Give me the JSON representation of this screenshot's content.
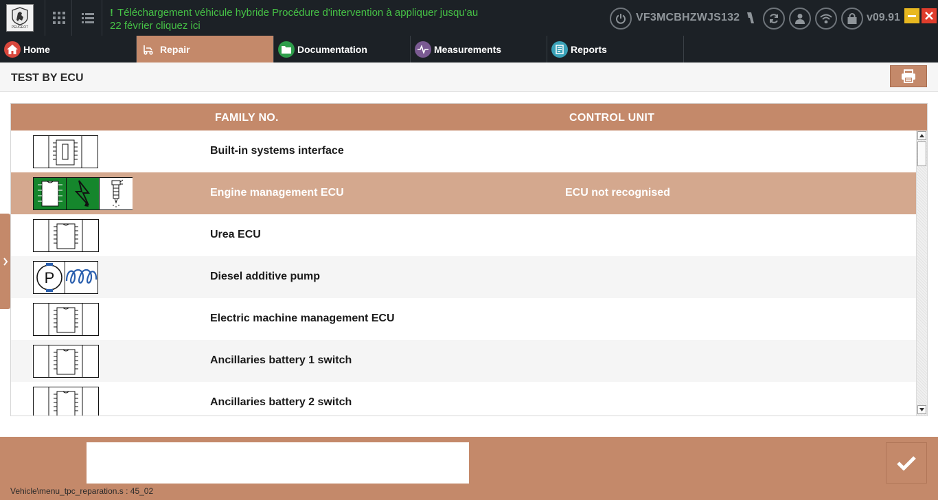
{
  "topbar": {
    "logo_text": "PEUGEOT",
    "notification_line1": "Téléchargement véhicule hybride Procédure d'intervention à appliquer jusqu'au",
    "notification_line2": "22 février cliquez ici",
    "notification_mark": "!",
    "vin": "VF3MCBHZWJS132",
    "version": "v09.91",
    "icons": [
      "grid-icon",
      "list-icon",
      "power-icon",
      "refresh-icon",
      "user-icon",
      "wifi-icon",
      "lock-icon",
      "minimize-icon",
      "close-icon"
    ]
  },
  "tabs": [
    {
      "label": "Home",
      "icon": "home-icon",
      "color": "#d9473c"
    },
    {
      "label": "Repair",
      "icon": "repair-icon",
      "color": "#c4896a"
    },
    {
      "label": "Documentation",
      "icon": "folder-icon",
      "color": "#2e9e4b"
    },
    {
      "label": "Measurements",
      "icon": "waveform-icon",
      "color": "#7a5a92"
    },
    {
      "label": "Reports",
      "icon": "report-icon",
      "color": "#3aa2b8"
    }
  ],
  "page": {
    "title": "TEST BY ECU"
  },
  "table": {
    "headers": {
      "family": "FAMILY NO.",
      "control_unit": "CONTROL UNIT"
    },
    "rows": [
      {
        "name": "Built-in systems interface",
        "control_unit": ""
      },
      {
        "name": "Engine management ECU",
        "control_unit": "ECU not recognised"
      },
      {
        "name": "Urea ECU",
        "control_unit": ""
      },
      {
        "name": "Diesel additive pump",
        "control_unit": ""
      },
      {
        "name": "Electric machine management ECU",
        "control_unit": ""
      },
      {
        "name": "Ancillaries battery 1 switch",
        "control_unit": ""
      },
      {
        "name": "Ancillaries battery 2 switch",
        "control_unit": ""
      }
    ]
  },
  "bottom": {
    "input_value": "",
    "status_path": "Vehicle\\menu_tpc_reparation.s : 45_02"
  },
  "colors": {
    "accent": "#c4896a",
    "topbar": "#1c2126",
    "notification": "#46c246",
    "ecu_green": "#15862c"
  }
}
